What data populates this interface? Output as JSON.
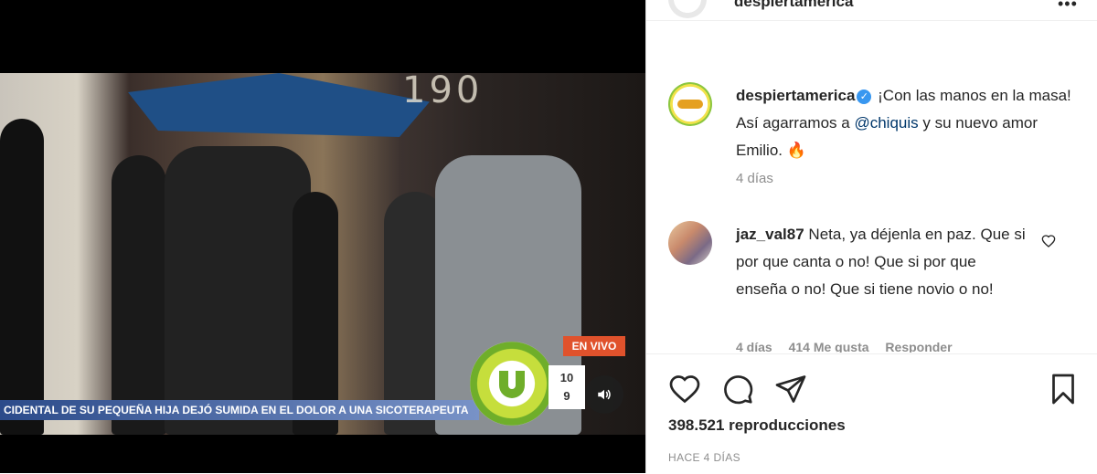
{
  "video": {
    "ticker_text": "CIDENTAL DE SU PEQUEÑA HIJA DEJÓ SUMIDA EN EL DOLOR A UNA SICOTERAPEUTA",
    "live_label": "EN VIVO",
    "building_number": "190",
    "time_line1": "10",
    "time_line2": "9"
  },
  "header": {
    "username": "despiertamerica"
  },
  "post": {
    "username": "despiertamerica",
    "caption_pre": " ¡Con las manos en la masa! Así agarramos a ",
    "mention": "@chiquis",
    "caption_post": " y su nuevo amor Emilio. 🔥",
    "time": "4 días"
  },
  "comment": {
    "username": "jaz_val87",
    "text": " Neta, ya déjenla en paz. Que si por que canta o no! Que si por que enseña o no! Que si tiene novio o no!",
    "time": "4 días",
    "likes": "414 Me gusta",
    "reply": "Responder"
  },
  "stats": {
    "views": "398.521 reproducciones",
    "posted": "HACE 4 DÍAS"
  },
  "colors": {
    "accent": "#3897f0",
    "live": "#e0522c",
    "ticker": "#2c4b8a"
  }
}
